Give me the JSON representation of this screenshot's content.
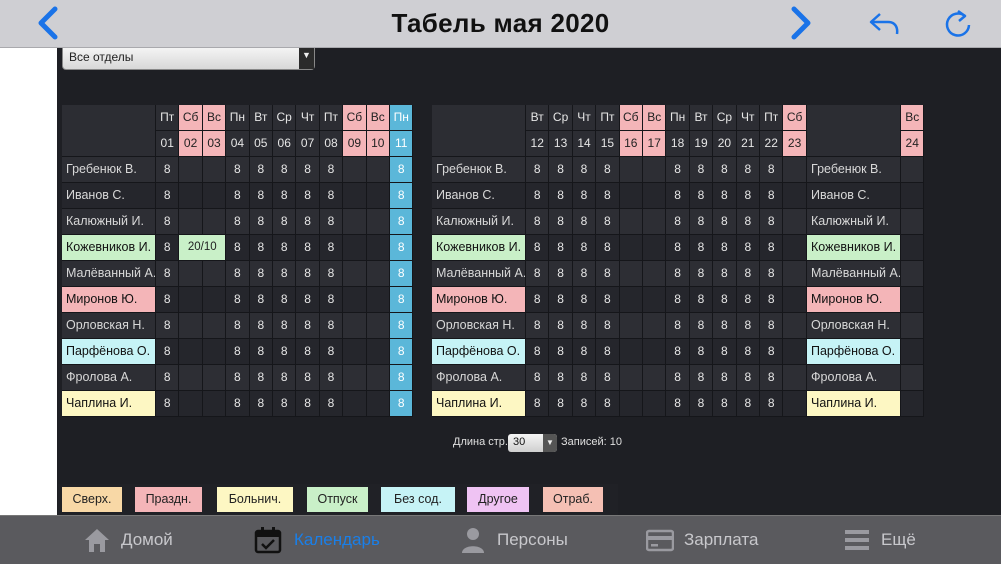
{
  "header": {
    "title": "Табель мая 2020"
  },
  "filter": {
    "department": "Все отделы"
  },
  "colors": {
    "weekend": "#f4b5b8",
    "today": "#5bb7d9",
    "row_header": "#2c2d33",
    "cell_a": "#2d2e34",
    "cell_b": "#25262c",
    "green": "#c9f0c8",
    "pink": "#f4b5b8",
    "cyan": "#c6f3f6",
    "yellow": "#fdf7c3"
  },
  "timesheet": {
    "blocks": [
      {
        "days": [
          {
            "dow": "Пт",
            "date": "01",
            "type": "work"
          },
          {
            "dow": "Сб",
            "date": "02",
            "type": "weekend"
          },
          {
            "dow": "Вс",
            "date": "03",
            "type": "weekend"
          },
          {
            "dow": "Пн",
            "date": "04",
            "type": "work"
          },
          {
            "dow": "Вт",
            "date": "05",
            "type": "work"
          },
          {
            "dow": "Ср",
            "date": "06",
            "type": "work"
          },
          {
            "dow": "Чт",
            "date": "07",
            "type": "work"
          },
          {
            "dow": "Пт",
            "date": "08",
            "type": "work"
          },
          {
            "dow": "Сб",
            "date": "09",
            "type": "weekend"
          },
          {
            "dow": "Вс",
            "date": "10",
            "type": "weekend"
          },
          {
            "dow": "Пн",
            "date": "11",
            "type": "today"
          }
        ]
      },
      {
        "days": [
          {
            "dow": "Вт",
            "date": "12",
            "type": "work"
          },
          {
            "dow": "Ср",
            "date": "13",
            "type": "work"
          },
          {
            "dow": "Чт",
            "date": "14",
            "type": "work"
          },
          {
            "dow": "Пт",
            "date": "15",
            "type": "work"
          },
          {
            "dow": "Сб",
            "date": "16",
            "type": "weekend"
          },
          {
            "dow": "Вс",
            "date": "17",
            "type": "weekend"
          },
          {
            "dow": "Пн",
            "date": "18",
            "type": "work"
          },
          {
            "dow": "Вт",
            "date": "19",
            "type": "work"
          },
          {
            "dow": "Ср",
            "date": "20",
            "type": "work"
          },
          {
            "dow": "Чт",
            "date": "21",
            "type": "work"
          },
          {
            "dow": "Пт",
            "date": "22",
            "type": "work"
          },
          {
            "dow": "Сб",
            "date": "23",
            "type": "weekend"
          }
        ]
      },
      {
        "days": [
          {
            "dow": "Вс",
            "date": "24",
            "type": "weekend"
          }
        ]
      }
    ],
    "employees": [
      {
        "name": "Гребенюк В.",
        "color": "none",
        "values": [
          "8",
          "",
          "",
          "8",
          "8",
          "8",
          "8",
          "8",
          "",
          "",
          "8",
          "8",
          "8",
          "8",
          "8",
          "",
          "",
          "8",
          "8",
          "8",
          "8",
          "8",
          "",
          ""
        ]
      },
      {
        "name": "Иванов С.",
        "color": "none",
        "values": [
          "8",
          "",
          "",
          "8",
          "8",
          "8",
          "8",
          "8",
          "",
          "",
          "8",
          "8",
          "8",
          "8",
          "8",
          "",
          "",
          "8",
          "8",
          "8",
          "8",
          "8",
          "",
          ""
        ]
      },
      {
        "name": "Калюжный И.",
        "color": "none",
        "values": [
          "8",
          "",
          "",
          "8",
          "8",
          "8",
          "8",
          "8",
          "",
          "",
          "8",
          "8",
          "8",
          "8",
          "8",
          "",
          "",
          "8",
          "8",
          "8",
          "8",
          "8",
          "",
          ""
        ]
      },
      {
        "name": "Кожевников И.",
        "color": "green",
        "values": [
          "8",
          "20/10",
          "",
          "8",
          "8",
          "8",
          "8",
          "8",
          "",
          "",
          "8",
          "8",
          "8",
          "8",
          "8",
          "",
          "",
          "8",
          "8",
          "8",
          "8",
          "8",
          "",
          ""
        ]
      },
      {
        "name": "Малёванный А.",
        "color": "none",
        "values": [
          "8",
          "",
          "",
          "8",
          "8",
          "8",
          "8",
          "8",
          "",
          "",
          "8",
          "8",
          "8",
          "8",
          "8",
          "",
          "",
          "8",
          "8",
          "8",
          "8",
          "8",
          "",
          ""
        ]
      },
      {
        "name": "Миронов Ю.",
        "color": "pink",
        "values": [
          "8",
          "",
          "",
          "8",
          "8",
          "8",
          "8",
          "8",
          "",
          "",
          "8",
          "8",
          "8",
          "8",
          "8",
          "",
          "",
          "8",
          "8",
          "8",
          "8",
          "8",
          "",
          ""
        ]
      },
      {
        "name": "Орловская Н.",
        "color": "none",
        "values": [
          "8",
          "",
          "",
          "8",
          "8",
          "8",
          "8",
          "8",
          "",
          "",
          "8",
          "8",
          "8",
          "8",
          "8",
          "",
          "",
          "8",
          "8",
          "8",
          "8",
          "8",
          "",
          ""
        ]
      },
      {
        "name": "Парфёнова О.",
        "color": "cyan",
        "values": [
          "8",
          "",
          "",
          "8",
          "8",
          "8",
          "8",
          "8",
          "",
          "",
          "8",
          "8",
          "8",
          "8",
          "8",
          "",
          "",
          "8",
          "8",
          "8",
          "8",
          "8",
          "",
          ""
        ]
      },
      {
        "name": "Фролова А.",
        "color": "none",
        "values": [
          "8",
          "",
          "",
          "8",
          "8",
          "8",
          "8",
          "8",
          "",
          "",
          "8",
          "8",
          "8",
          "8",
          "8",
          "",
          "",
          "8",
          "8",
          "8",
          "8",
          "8",
          "",
          ""
        ]
      },
      {
        "name": "Чаплина И.",
        "color": "yellow",
        "values": [
          "8",
          "",
          "",
          "8",
          "8",
          "8",
          "8",
          "8",
          "",
          "",
          "8",
          "8",
          "8",
          "8",
          "8",
          "",
          "",
          "8",
          "8",
          "8",
          "8",
          "8",
          "",
          ""
        ]
      }
    ]
  },
  "pager": {
    "label": "Длина стр.",
    "page_size": "30",
    "records": "Записей: 10"
  },
  "legend": [
    {
      "label": "Сверх.",
      "color": "#f8d8a6"
    },
    {
      "label": "Праздн.",
      "color": "#f4b5b8"
    },
    {
      "label": "Больнич.",
      "color": "#fdf7c3"
    },
    {
      "label": "Отпуск",
      "color": "#c9f0c8"
    },
    {
      "label": "Без сод.",
      "color": "#c6f3f6"
    },
    {
      "label": "Другое",
      "color": "#efc3f3"
    },
    {
      "label": "Отраб.",
      "color": "#f5c0b4"
    }
  ],
  "tabbar": {
    "tabs": [
      {
        "label": "Домой",
        "icon": "home-icon",
        "active": false
      },
      {
        "label": "Календарь",
        "icon": "calendar-check-icon",
        "active": true
      },
      {
        "label": "Персоны",
        "icon": "person-icon",
        "active": false
      },
      {
        "label": "Зарплата",
        "icon": "credit-card-icon",
        "active": false
      },
      {
        "label": "Ещё",
        "icon": "menu-icon",
        "active": false
      }
    ]
  }
}
